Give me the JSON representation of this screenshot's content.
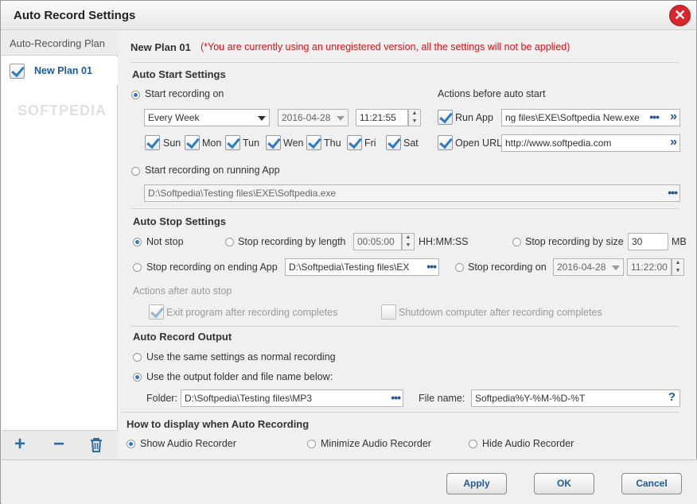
{
  "window": {
    "title": "Auto Record Settings"
  },
  "sidebar": {
    "header": "Auto-Recording Plan",
    "items": [
      {
        "label": "New Plan 01",
        "checked": true
      }
    ],
    "watermark": "SOFTPEDIA",
    "actions": [
      "add-icon",
      "remove-icon",
      "trash-icon"
    ]
  },
  "plan": {
    "name": "New Plan 01",
    "warning": "(*You are currently using an unregistered version, all the settings will not be applied)"
  },
  "auto_start": {
    "heading": "Auto Start Settings",
    "start_on_label": "Start recording on",
    "frequency": "Every Week",
    "date": "2016-04-28",
    "time": "11:21:55",
    "days": [
      {
        "label": "Sun",
        "checked": true
      },
      {
        "label": "Mon",
        "checked": true
      },
      {
        "label": "Tun",
        "checked": true
      },
      {
        "label": "Wen",
        "checked": true
      },
      {
        "label": "Thu",
        "checked": true
      },
      {
        "label": "Fri",
        "checked": true
      },
      {
        "label": "Sat",
        "checked": true
      }
    ],
    "running_app_label": "Start recording on running App",
    "running_app_path": "D:\\Softpedia\\Testing files\\EXE\\Softpedia.exe",
    "actions_heading": "Actions before auto start",
    "run_app_label": "Run App",
    "run_app_path": "ng files\\EXE\\Softpedia New.exe",
    "open_url_label": "Open URL",
    "open_url_value": "http://www.softpedia.com"
  },
  "auto_stop": {
    "heading": "Auto Stop Settings",
    "not_stop_label": "Not stop",
    "by_length_label": "Stop recording by length",
    "length_value": "00:05:00",
    "length_unit": "HH:MM:SS",
    "by_size_label": "Stop recording by size",
    "size_value": "30",
    "size_unit": "MB",
    "ending_app_label": "Stop recording on ending App",
    "ending_app_path": "D:\\Softpedia\\Testing files\\EX",
    "stop_on_label": "Stop recording on",
    "stop_date": "2016-04-28",
    "stop_time": "11:22:00",
    "after_heading": "Actions after auto stop",
    "exit_program_label": "Exit program after recording completes",
    "shutdown_label": "Shutdown computer after recording completes"
  },
  "output": {
    "heading": "Auto Record Output",
    "same_settings_label": "Use the same settings as normal recording",
    "custom_label": "Use the output folder and file name below:",
    "folder_label": "Folder:",
    "folder_value": "D:\\Softpedia\\Testing files\\MP3",
    "filename_label": "File name:",
    "filename_value": "Softpedia%Y-%M-%D-%T",
    "help_glyph": "?"
  },
  "display": {
    "heading": "How to display when Auto Recording",
    "show_label": "Show Audio Recorder",
    "minimize_label": "Minimize Audio Recorder",
    "hide_label": "Hide Audio Recorder"
  },
  "footer": {
    "apply": "Apply",
    "ok": "OK",
    "cancel": "Cancel"
  },
  "colors": {
    "accent": "#2a7bc4",
    "warning": "#d0141b",
    "close": "#d9262b"
  }
}
